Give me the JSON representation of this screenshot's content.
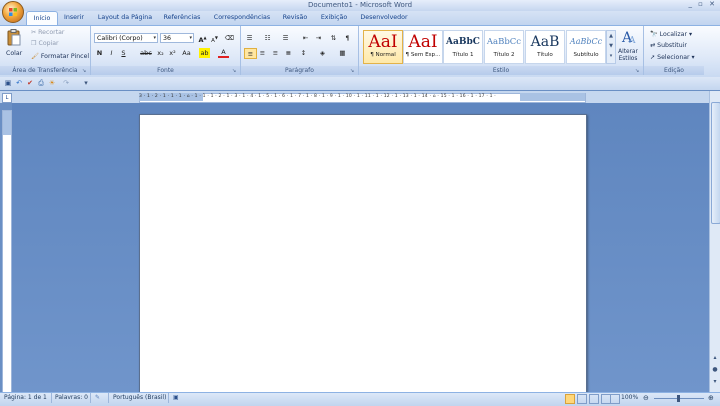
{
  "window": {
    "title": "Documento1 - Microsoft Word",
    "controls": "_ ▫ ✕"
  },
  "tabs": [
    {
      "label": "Início"
    },
    {
      "label": "Inserir"
    },
    {
      "label": "Layout da Página"
    },
    {
      "label": "Referências"
    },
    {
      "label": "Correspondências"
    },
    {
      "label": "Revisão"
    },
    {
      "label": "Exibição"
    },
    {
      "label": "Desenvolvedor"
    }
  ],
  "clipboard": {
    "paste": "Colar",
    "cut": "Recortar",
    "copy": "Copiar",
    "format_painter": "Formatar Pincel",
    "label": "Área de Transferência"
  },
  "font": {
    "name": "Calibri (Corpo)",
    "size": "36",
    "label": "Fonte",
    "bold": "N",
    "italic": "I",
    "underline": "S",
    "strike": "abc",
    "subscript": "x₂",
    "superscript": "x²",
    "change_case": "Aa",
    "grow": "A",
    "shrink": "A"
  },
  "paragraph": {
    "label": "Parágrafo"
  },
  "styles": {
    "label": "Estilo",
    "items": [
      {
        "sample": "AaI",
        "name": "¶ Normal"
      },
      {
        "sample": "AaI",
        "name": "¶ Sem Esp..."
      },
      {
        "sample": "AaBbC",
        "name": "Título 1"
      },
      {
        "sample": "AaBbCc",
        "name": "Título 2"
      },
      {
        "sample": "AaB",
        "name": "Título"
      },
      {
        "sample": "AaBbCc",
        "name": "Subtítulo"
      }
    ],
    "change_styles": "Alterar Estilos"
  },
  "editing": {
    "label": "Edição",
    "find": "Localizar",
    "replace": "Substituir",
    "select": "Selecionar"
  },
  "ruler": {
    "numbers": "3 · 1 · 2 · 1 · 1 · 1 · ⌂ · 1 · 1 · 1 · 2 · 1 · 3 · 1 · 4 · 1 · 5 · 1 · 6 · 1 · 7 · 1 · 8 · 1 · 9 · 1 · 10 · 1 · 11 · 1 · 12 · 1 · 13 · 1 · 14 · ⌂ · 15 · 1 · 16 · 1 · 17 · 1 ·"
  },
  "status": {
    "page": "Página: 1 de 1",
    "words": "Palavras: 0",
    "language": "Português (Brasil)",
    "zoom": "100%"
  },
  "colors": {
    "accent": "#15428b",
    "ribbon_bg": "#dfe9f8",
    "doc_bg": "#6a8fc4"
  }
}
